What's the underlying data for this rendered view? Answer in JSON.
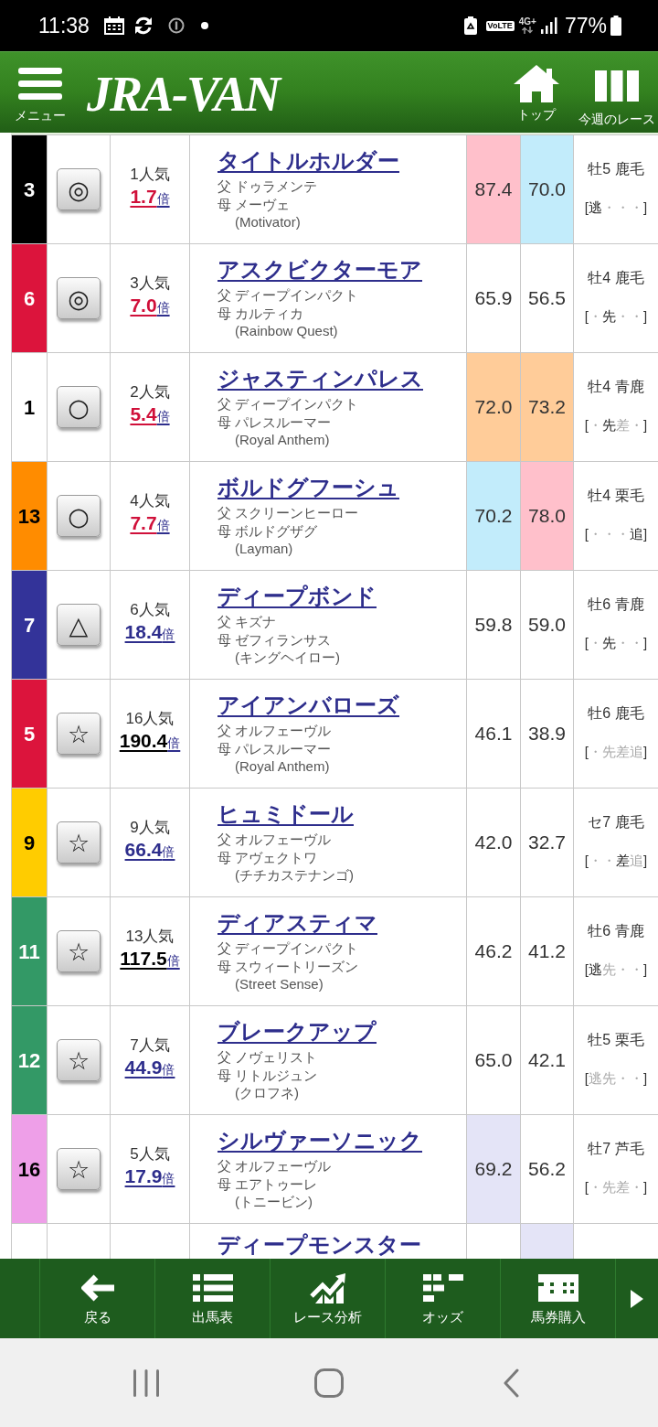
{
  "status_bar": {
    "time": "11:38",
    "volte": "VoLTE",
    "network": "4G+",
    "battery": "77%"
  },
  "header": {
    "menu_label": "メニュー",
    "logo": "JRA-VAN",
    "actions": [
      {
        "kind": "home",
        "label": "トップ"
      },
      {
        "kind": "races",
        "label": "今週のレース"
      }
    ]
  },
  "rows": [
    {
      "post": {
        "number": "3",
        "color": "#000000"
      },
      "mark": "◎",
      "popularity": "1人気",
      "odds": {
        "value": "1.7",
        "unit": "倍",
        "color": "#d0103a"
      },
      "name": "タイトルホルダー",
      "sire": "父 ドゥラメンテ",
      "dam": "母 メーヴェ",
      "dam_sire": "(Motivator)",
      "scores": [
        {
          "value": "87.4",
          "color": "#ffc0cb"
        },
        {
          "value": "70.0",
          "color": "#c2ecfb"
        }
      ],
      "profile": "牡5 鹿毛",
      "style": {
        "open": "[",
        "slots": [
          {
            "text": "逃",
            "strong": true
          },
          {
            "text": "・",
            "strong": false
          },
          {
            "text": "・",
            "strong": false
          },
          {
            "text": "・",
            "strong": false
          }
        ],
        "close": "]"
      }
    },
    {
      "post": {
        "number": "6",
        "color": "#dc143c"
      },
      "mark": "◎",
      "popularity": "3人気",
      "odds": {
        "value": "7.0",
        "unit": "倍",
        "color": "#d0103a"
      },
      "name": "アスクビクターモア",
      "sire": "父 ディープインパクト",
      "dam": "母 カルティカ",
      "dam_sire": "(Rainbow Quest)",
      "scores": [
        {
          "value": "65.9",
          "color": "#ffffff"
        },
        {
          "value": "56.5",
          "color": "#ffffff"
        }
      ],
      "profile": "牡4 鹿毛",
      "style": {
        "open": "[",
        "slots": [
          {
            "text": "・",
            "strong": false
          },
          {
            "text": "先",
            "strong": true
          },
          {
            "text": "・",
            "strong": false
          },
          {
            "text": "・",
            "strong": false
          }
        ],
        "close": "]"
      }
    },
    {
      "post": {
        "number": "1",
        "color": "#ffffff"
      },
      "mark": "○",
      "popularity": "2人気",
      "odds": {
        "value": "5.4",
        "unit": "倍",
        "color": "#d0103a"
      },
      "name": "ジャスティンパレス",
      "sire": "父 ディープインパクト",
      "dam": "母 パレスルーマー",
      "dam_sire": "(Royal Anthem)",
      "scores": [
        {
          "value": "72.0",
          "color": "#ffcc99"
        },
        {
          "value": "73.2",
          "color": "#ffcc99"
        }
      ],
      "profile": "牡4 青鹿",
      "style": {
        "open": "[",
        "slots": [
          {
            "text": "・",
            "strong": false
          },
          {
            "text": "先",
            "strong": true
          },
          {
            "text": "差",
            "strong": false
          },
          {
            "text": "・",
            "strong": false
          }
        ],
        "close": "]"
      }
    },
    {
      "post": {
        "number": "13",
        "color": "#ff8c00"
      },
      "mark": "○",
      "popularity": "4人気",
      "odds": {
        "value": "7.7",
        "unit": "倍",
        "color": "#d0103a"
      },
      "name": "ボルドグフーシュ",
      "sire": "父 スクリーンヒーロー",
      "dam": "母 ボルドグザグ",
      "dam_sire": "(Layman)",
      "scores": [
        {
          "value": "70.2",
          "color": "#c2ecfb"
        },
        {
          "value": "78.0",
          "color": "#ffc0cb"
        }
      ],
      "profile": "牡4 栗毛",
      "style": {
        "open": "[",
        "slots": [
          {
            "text": "・",
            "strong": false
          },
          {
            "text": "・",
            "strong": false
          },
          {
            "text": "・",
            "strong": false
          },
          {
            "text": "追",
            "strong": true
          }
        ],
        "close": "]"
      }
    },
    {
      "post": {
        "number": "7",
        "color": "#333399"
      },
      "mark": "△",
      "popularity": "6人気",
      "odds": {
        "value": "18.4",
        "unit": "倍",
        "color": "#2e2e8c"
      },
      "name": "ディープボンド",
      "sire": "父 キズナ",
      "dam": "母 ゼフィランサス",
      "dam_sire": "(キングヘイロー)",
      "scores": [
        {
          "value": "59.8",
          "color": "#ffffff"
        },
        {
          "value": "59.0",
          "color": "#ffffff"
        }
      ],
      "profile": "牡6 青鹿",
      "style": {
        "open": "[",
        "slots": [
          {
            "text": "・",
            "strong": false
          },
          {
            "text": "先",
            "strong": true
          },
          {
            "text": "・",
            "strong": false
          },
          {
            "text": "・",
            "strong": false
          }
        ],
        "close": "]"
      }
    },
    {
      "post": {
        "number": "5",
        "color": "#dc143c"
      },
      "mark": "☆",
      "popularity": "16人気",
      "odds": {
        "value": "190.4",
        "unit": "倍",
        "color": "#000000"
      },
      "name": "アイアンバローズ",
      "sire": "父 オルフェーヴル",
      "dam": "母 パレスルーマー",
      "dam_sire": "(Royal Anthem)",
      "scores": [
        {
          "value": "46.1",
          "color": "#ffffff"
        },
        {
          "value": "38.9",
          "color": "#ffffff"
        }
      ],
      "profile": "牡6 鹿毛",
      "style": {
        "open": "[",
        "slots": [
          {
            "text": "・",
            "strong": false
          },
          {
            "text": "先",
            "strong": false
          },
          {
            "text": "差",
            "strong": false
          },
          {
            "text": "追",
            "strong": false
          }
        ],
        "close": "]"
      }
    },
    {
      "post": {
        "number": "9",
        "color": "#ffcc00"
      },
      "mark": "☆",
      "popularity": "9人気",
      "odds": {
        "value": "66.4",
        "unit": "倍",
        "color": "#2e2e8c"
      },
      "name": "ヒュミドール",
      "sire": "父 オルフェーヴル",
      "dam": "母 アヴェクトワ",
      "dam_sire": "(チチカステナンゴ)",
      "scores": [
        {
          "value": "42.0",
          "color": "#ffffff"
        },
        {
          "value": "32.7",
          "color": "#ffffff"
        }
      ],
      "profile": "セ7 鹿毛",
      "style": {
        "open": "[",
        "slots": [
          {
            "text": "・",
            "strong": false
          },
          {
            "text": "・",
            "strong": false
          },
          {
            "text": "差",
            "strong": true
          },
          {
            "text": "追",
            "strong": false
          }
        ],
        "close": "]"
      }
    },
    {
      "post": {
        "number": "11",
        "color": "#339966"
      },
      "mark": "☆",
      "popularity": "13人気",
      "odds": {
        "value": "117.5",
        "unit": "倍",
        "color": "#000000"
      },
      "name": "ディアスティマ",
      "sire": "父 ディープインパクト",
      "dam": "母 スウィートリーズン",
      "dam_sire": "(Street Sense)",
      "scores": [
        {
          "value": "46.2",
          "color": "#ffffff"
        },
        {
          "value": "41.2",
          "color": "#ffffff"
        }
      ],
      "profile": "牡6 青鹿",
      "style": {
        "open": "[",
        "slots": [
          {
            "text": "逃",
            "strong": true
          },
          {
            "text": "先",
            "strong": false
          },
          {
            "text": "・",
            "strong": false
          },
          {
            "text": "・",
            "strong": false
          }
        ],
        "close": "]"
      }
    },
    {
      "post": {
        "number": "12",
        "color": "#339966"
      },
      "mark": "☆",
      "popularity": "7人気",
      "odds": {
        "value": "44.9",
        "unit": "倍",
        "color": "#2e2e8c"
      },
      "name": "ブレークアップ",
      "sire": "父 ノヴェリスト",
      "dam": "母 リトルジュン",
      "dam_sire": "(クロフネ)",
      "scores": [
        {
          "value": "65.0",
          "color": "#ffffff"
        },
        {
          "value": "42.1",
          "color": "#ffffff"
        }
      ],
      "profile": "牡5 栗毛",
      "style": {
        "open": "[",
        "slots": [
          {
            "text": "逃",
            "strong": false
          },
          {
            "text": "先",
            "strong": false
          },
          {
            "text": "・",
            "strong": false
          },
          {
            "text": "・",
            "strong": false
          }
        ],
        "close": "]"
      }
    },
    {
      "post": {
        "number": "16",
        "color": "#ee9fe8"
      },
      "mark": "☆",
      "popularity": "5人気",
      "odds": {
        "value": "17.9",
        "unit": "倍",
        "color": "#2e2e8c"
      },
      "name": "シルヴァーソニック",
      "sire": "父 オルフェーヴル",
      "dam": "母 エアトゥーレ",
      "dam_sire": "(トニービン)",
      "scores": [
        {
          "value": "69.2",
          "color": "#e4e4f7"
        },
        {
          "value": "56.2",
          "color": "#ffffff"
        }
      ],
      "profile": "牡7 芦毛",
      "style": {
        "open": "[",
        "slots": [
          {
            "text": "・",
            "strong": false
          },
          {
            "text": "先",
            "strong": false
          },
          {
            "text": "差",
            "strong": false
          },
          {
            "text": "・",
            "strong": false
          }
        ],
        "close": "]"
      }
    }
  ],
  "partial_row": {
    "post": {
      "color": "#ffffff"
    },
    "name": "ディープモンスター",
    "scores": [
      {
        "color": "#ffffff"
      },
      {
        "color": "#e4e4f7"
      }
    ]
  },
  "bottom_nav": {
    "items": [
      {
        "kind": "back",
        "label": "戻る"
      },
      {
        "kind": "entries",
        "label": "出馬表"
      },
      {
        "kind": "analysis",
        "label": "レース分析"
      },
      {
        "kind": "odds",
        "label": "オッズ"
      },
      {
        "kind": "ticket",
        "label": "馬券購入"
      }
    ]
  }
}
